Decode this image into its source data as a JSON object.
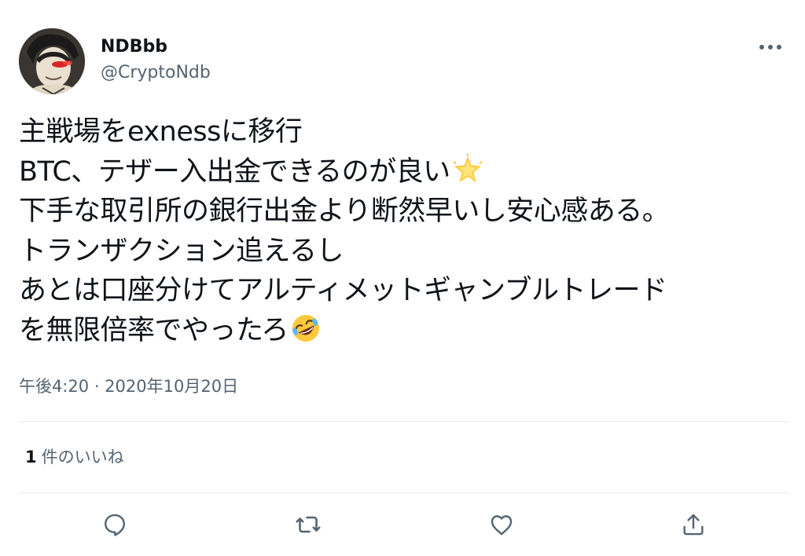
{
  "tweet": {
    "author": {
      "display_name": "NDBbb",
      "handle": "@CryptoNdb"
    },
    "body_lines": [
      "主戦場をexnessに移行",
      "BTC、テザー入出金できるのが良い",
      "下手な取引所の銀行出金より断然早いし安心感ある。",
      "トランザクション追えるし",
      "あとは口座分けてアルティメットギャンブルトレード",
      "を無限倍率でやったろ"
    ],
    "emojis": {
      "line2": "glowing-star-emoji",
      "line6": "rolling-on-floor-laughing-emoji"
    },
    "timestamp": "午後4:20 · 2020年10月20日",
    "likes": {
      "count": "1",
      "label": "件のいいね"
    },
    "icons": {
      "more": "more-horizontal-icon",
      "reply": "reply-icon",
      "retweet": "retweet-icon",
      "like": "heart-icon",
      "share": "share-icon"
    },
    "colors": {
      "text_primary": "#0f1419",
      "text_secondary": "#536471",
      "divider": "#e6ecf0"
    }
  }
}
